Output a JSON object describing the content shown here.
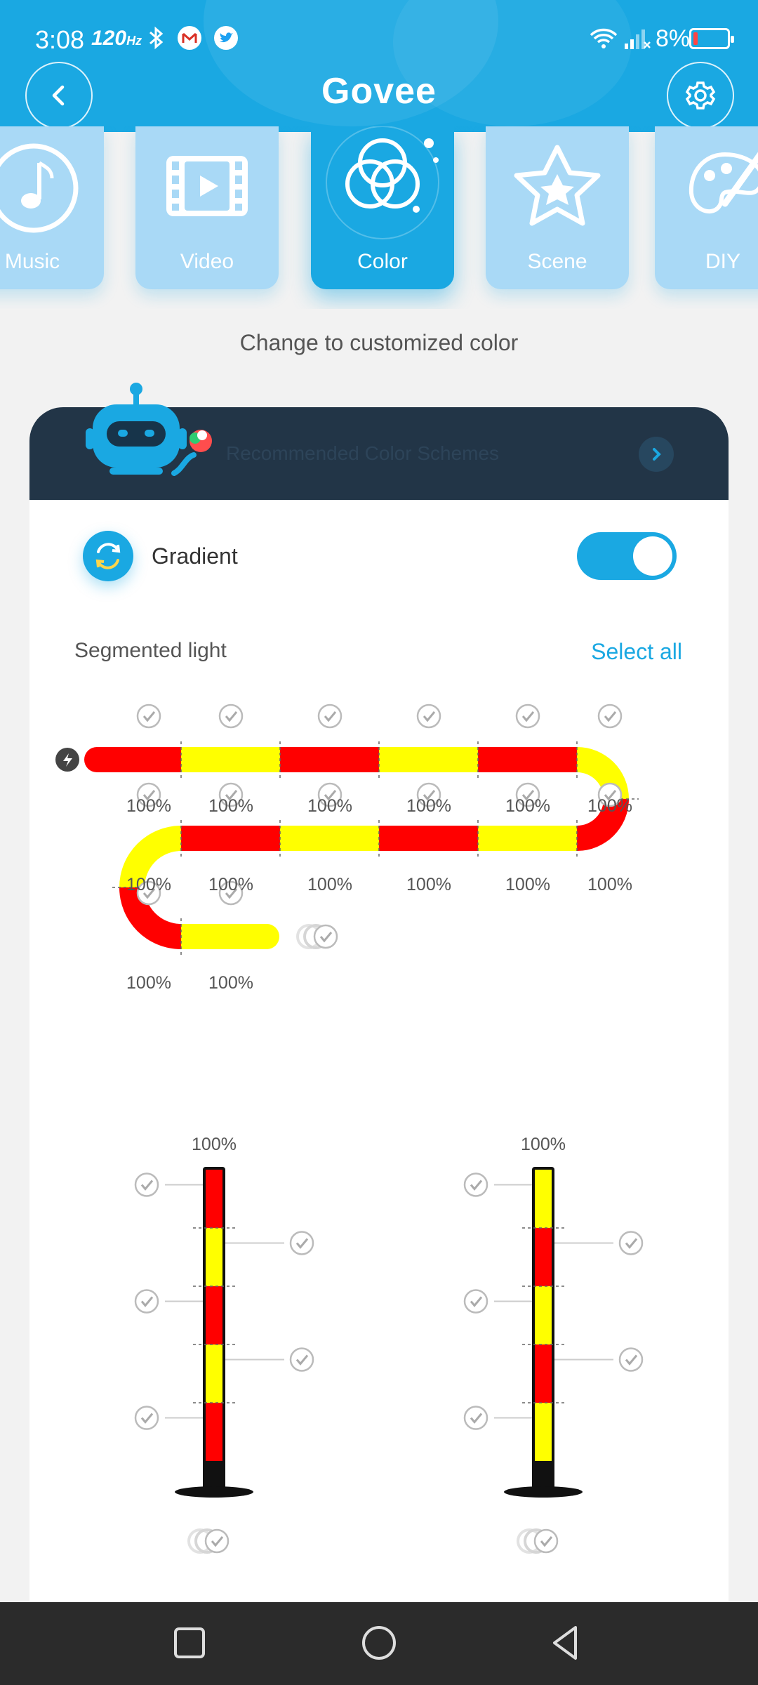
{
  "status": {
    "time": "3:08",
    "refresh": "120",
    "refresh_unit": "Hz",
    "battery": "8%",
    "icons": [
      "bluetooth-icon",
      "gmail-icon",
      "twitter-icon",
      "wifi-icon",
      "signal-icon",
      "battery-icon"
    ]
  },
  "header": {
    "logo": "Govee",
    "back_icon": "chevron-left-icon",
    "settings_icon": "gear-icon"
  },
  "tabs": [
    {
      "label": "Music",
      "icon": "music-note-icon",
      "active": false
    },
    {
      "label": "Video",
      "icon": "video-icon",
      "active": false
    },
    {
      "label": "Color",
      "icon": "color-circles-icon",
      "active": true
    },
    {
      "label": "Scene",
      "icon": "star-icon",
      "active": false
    },
    {
      "label": "DIY",
      "icon": "palette-icon",
      "active": false
    }
  ],
  "subtitle": "Change to customized color",
  "recommend": {
    "text": "Recommended Color Schemes"
  },
  "gradient": {
    "label": "Gradient",
    "enabled": true
  },
  "segmented": {
    "label": "Segmented light",
    "select_all": "Select all",
    "colors": {
      "red": "#ff0000",
      "yellow": "#ffff00",
      "accent": "#1aa8e2"
    },
    "strip": {
      "row1": [
        {
          "color": "red",
          "brightness": "100%"
        },
        {
          "color": "yellow",
          "brightness": "100%"
        },
        {
          "color": "red",
          "brightness": "100%"
        },
        {
          "color": "yellow",
          "brightness": "100%"
        },
        {
          "color": "red",
          "brightness": "100%"
        },
        {
          "color": "yellow",
          "brightness": "100%"
        }
      ],
      "row2": [
        {
          "color": "red",
          "brightness": "100%"
        },
        {
          "color": "yellow",
          "brightness": "100%"
        },
        {
          "color": "red",
          "brightness": "100%"
        },
        {
          "color": "yellow",
          "brightness": "100%"
        },
        {
          "color": "red",
          "brightness": "100%"
        },
        {
          "color": "yellow",
          "brightness": "100%"
        }
      ],
      "row3": [
        {
          "color": "red",
          "brightness": "100%"
        },
        {
          "color": "yellow",
          "brightness": "100%"
        }
      ]
    },
    "pole_left": {
      "brightness": "100%",
      "colors": [
        "red",
        "yellow",
        "red",
        "yellow",
        "red"
      ]
    },
    "pole_right": {
      "brightness": "100%",
      "colors": [
        "yellow",
        "red",
        "yellow",
        "red",
        "yellow"
      ]
    }
  },
  "navbar": {
    "icons": [
      "recent-apps-icon",
      "home-icon",
      "back-icon"
    ]
  }
}
